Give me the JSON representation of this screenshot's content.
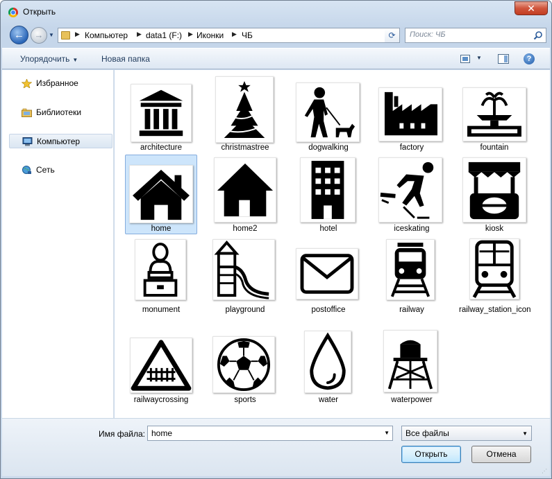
{
  "window": {
    "title": "Открыть",
    "close_label": "✕"
  },
  "nav": {
    "breadcrumbs": [
      "Компьютер",
      "data1 (F:)",
      "Иконки",
      "ЧБ"
    ],
    "search_placeholder": "Поиск: ЧБ"
  },
  "toolbar": {
    "organize_label": "Упорядочить",
    "new_folder_label": "Новая папка"
  },
  "sidebar": {
    "items": [
      {
        "label": "Избранное",
        "icon": "star-icon"
      },
      {
        "label": "Библиотеки",
        "icon": "library-icon"
      },
      {
        "label": "Компьютер",
        "icon": "computer-icon",
        "selected": true
      },
      {
        "label": "Сеть",
        "icon": "network-icon"
      }
    ]
  },
  "files": [
    {
      "name": "architecture",
      "icon": "architecture-icon"
    },
    {
      "name": "christmastree",
      "icon": "christmastree-icon"
    },
    {
      "name": "dogwalking",
      "icon": "dogwalking-icon"
    },
    {
      "name": "factory",
      "icon": "factory-icon"
    },
    {
      "name": "fountain",
      "icon": "fountain-icon"
    },
    {
      "name": "home",
      "icon": "home-icon",
      "selected": true
    },
    {
      "name": "home2",
      "icon": "home2-icon"
    },
    {
      "name": "hotel",
      "icon": "hotel-icon"
    },
    {
      "name": "iceskating",
      "icon": "iceskating-icon"
    },
    {
      "name": "kiosk",
      "icon": "kiosk-icon"
    },
    {
      "name": "monument",
      "icon": "monument-icon"
    },
    {
      "name": "playground",
      "icon": "playground-icon"
    },
    {
      "name": "postoffice",
      "icon": "postoffice-icon"
    },
    {
      "name": "railway",
      "icon": "railway-icon"
    },
    {
      "name": "railway_station_icon",
      "icon": "railway-station-icon"
    },
    {
      "name": "railwaycrossing",
      "icon": "railwaycrossing-icon"
    },
    {
      "name": "sports",
      "icon": "soccer-ball-icon"
    },
    {
      "name": "water",
      "icon": "water-drop-icon"
    },
    {
      "name": "waterpower",
      "icon": "water-tower-icon"
    }
  ],
  "footer": {
    "filename_label": "Имя файла:",
    "filename_value": "home",
    "filter_value": "Все файлы",
    "open_label": "Открыть",
    "cancel_label": "Отмена"
  },
  "colors": {
    "selection_bg": "#cde5fb",
    "selection_border": "#84acdd",
    "frame": "#c5d6ea"
  }
}
